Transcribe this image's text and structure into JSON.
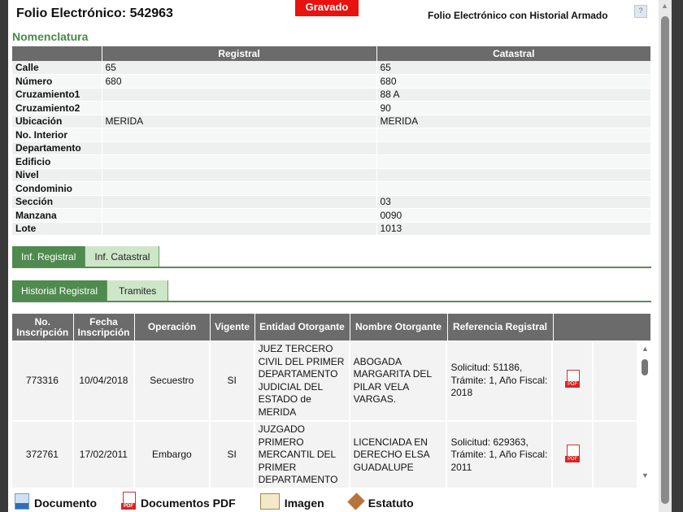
{
  "header": {
    "title": "Folio Electrónico: 542963",
    "status": "Gravado",
    "right_title": "Folio Electrónico con Historial Armado",
    "help": "?"
  },
  "nomenclatura": {
    "title": "Nomenclatura",
    "columns": [
      "",
      "Registral",
      "Catastral"
    ],
    "rows": [
      [
        "Calle",
        "65",
        "65"
      ],
      [
        "Número",
        "680",
        "680"
      ],
      [
        "Cruzamiento1",
        "",
        "88 A"
      ],
      [
        "Cruzamiento2",
        "",
        "90"
      ],
      [
        "Ubicación",
        "MERIDA",
        "MERIDA"
      ],
      [
        "No. Interior",
        "",
        ""
      ],
      [
        "Departamento",
        "",
        ""
      ],
      [
        "Edificio",
        "",
        ""
      ],
      [
        "Nivel",
        "",
        ""
      ],
      [
        "Condominio",
        "",
        ""
      ],
      [
        "Sección",
        "",
        "03"
      ],
      [
        "Manzana",
        "",
        "0090"
      ],
      [
        "Lote",
        "",
        "1013"
      ]
    ]
  },
  "tabs1": [
    "Inf. Registral",
    "Inf. Catastral"
  ],
  "tabs2": [
    "Historial Registral",
    "Tramites"
  ],
  "grid": {
    "columns": [
      "No. Inscripción",
      "Fecha Inscripción",
      "Operación",
      "Vigente",
      "Entidad Otorgante",
      "Nombre Otorgante",
      "Referencia Registral",
      ""
    ],
    "rows": [
      [
        "773316",
        "10/04/2018",
        "Secuestro",
        "SI",
        "JUEZ TERCERO CIVIL DEL PRIMER DEPARTAMENTO JUDICIAL DEL ESTADO de MERIDA",
        "ABOGADA MARGARITA DEL PILAR VELA VARGAS.",
        "Solicitud: 51186, Trámite: 1, Año Fiscal: 2018"
      ],
      [
        "372761",
        "17/02/2011",
        "Embargo",
        "SI",
        "JUZGADO PRIMERO MERCANTIL DEL PRIMER DEPARTAMENTO",
        "LICENCIADA EN DERECHO ELSA GUADALUPE",
        "Solicitud: 629363, Trámite: 1, Año Fiscal: 2011"
      ]
    ]
  },
  "footer": [
    "Documento",
    "Documentos PDF",
    "Imagen",
    "Estatuto"
  ]
}
